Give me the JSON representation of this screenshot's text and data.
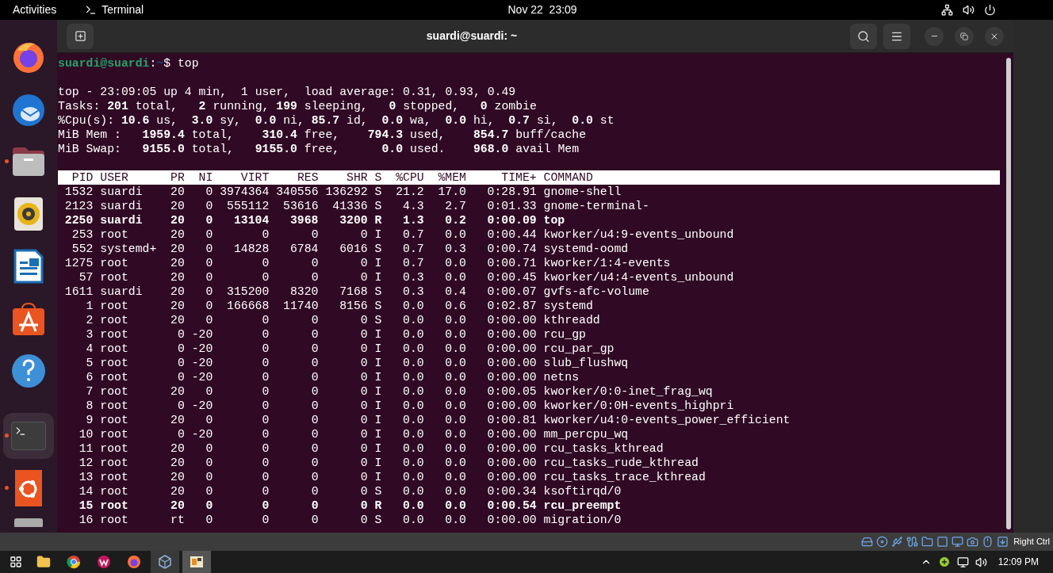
{
  "top_bar": {
    "activities": "Activities",
    "app_name": "Terminal",
    "clock": "Nov 22  23:09"
  },
  "dock": [
    {
      "kind": "firefox",
      "running": false,
      "active": false
    },
    {
      "kind": "thunderbird",
      "running": false,
      "active": false
    },
    {
      "kind": "files",
      "running": true,
      "active": false
    },
    {
      "kind": "rhythmbox",
      "running": false,
      "active": false
    },
    {
      "kind": "writer",
      "running": false,
      "active": false
    },
    {
      "kind": "software",
      "running": false,
      "active": false
    },
    {
      "kind": "help",
      "running": false,
      "active": false
    },
    {
      "kind": "separator"
    },
    {
      "kind": "terminal",
      "running": true,
      "active": true
    },
    {
      "kind": "ubuntu",
      "running": true,
      "active": false
    },
    {
      "kind": "drive"
    }
  ],
  "window": {
    "title": "suardi@suardi: ~"
  },
  "terminal": {
    "prompt": {
      "user_host": "suardi@suardi",
      "separator": ":",
      "path": "~",
      "symbol": "$ ",
      "command": "top"
    },
    "summary": [
      "top - 23:09:05 up 4 min,  1 user,  load average: 0.31, 0.93, 0.49",
      "Tasks: **201** total,   **2** running, **199** sleeping,   **0** stopped,   **0** zombie",
      "%Cpu(s): **10.6** us,  **3.0** sy,  **0.0** ni, **85.7** id,  **0.0** wa,  **0.0** hi,  **0.7** si,  **0.0** st",
      "MiB Mem :   **1959.4** total,    **310.4** free,    **794.3** used,    **854.7** buff/cache",
      "MiB Swap:   **9155.0** total,   **9155.0** free,      **0.0** used.    **968.0** avail Mem"
    ],
    "columns": [
      "PID",
      "USER",
      "PR",
      "NI",
      "VIRT",
      "RES",
      "SHR",
      "S",
      "%CPU",
      "%MEM",
      "TIME+",
      "COMMAND"
    ],
    "rows": [
      {
        "bold": false,
        "cells": [
          "1532",
          "suardi",
          "20",
          "0",
          "3974364",
          "340556",
          "136292",
          "S",
          "21.2",
          "17.0",
          "0:28.91",
          "gnome-shell"
        ]
      },
      {
        "bold": false,
        "cells": [
          "2123",
          "suardi",
          "20",
          "0",
          "555112",
          "53616",
          "41336",
          "S",
          "4.3",
          "2.7",
          "0:01.33",
          "gnome-terminal-"
        ]
      },
      {
        "bold": true,
        "cells": [
          "2250",
          "suardi",
          "20",
          "0",
          "13104",
          "3968",
          "3200",
          "R",
          "1.3",
          "0.2",
          "0:00.09",
          "top"
        ]
      },
      {
        "bold": false,
        "cells": [
          "253",
          "root",
          "20",
          "0",
          "0",
          "0",
          "0",
          "I",
          "0.7",
          "0.0",
          "0:00.44",
          "kworker/u4:9-events_unbound"
        ]
      },
      {
        "bold": false,
        "cells": [
          "552",
          "systemd+",
          "20",
          "0",
          "14828",
          "6784",
          "6016",
          "S",
          "0.7",
          "0.3",
          "0:00.74",
          "systemd-oomd"
        ]
      },
      {
        "bold": false,
        "cells": [
          "1275",
          "root",
          "20",
          "0",
          "0",
          "0",
          "0",
          "I",
          "0.7",
          "0.0",
          "0:00.71",
          "kworker/1:4-events"
        ]
      },
      {
        "bold": false,
        "cells": [
          "57",
          "root",
          "20",
          "0",
          "0",
          "0",
          "0",
          "I",
          "0.3",
          "0.0",
          "0:00.45",
          "kworker/u4:4-events_unbound"
        ]
      },
      {
        "bold": false,
        "cells": [
          "1611",
          "suardi",
          "20",
          "0",
          "315200",
          "8320",
          "7168",
          "S",
          "0.3",
          "0.4",
          "0:00.07",
          "gvfs-afc-volume"
        ]
      },
      {
        "bold": false,
        "cells": [
          "1",
          "root",
          "20",
          "0",
          "166668",
          "11740",
          "8156",
          "S",
          "0.0",
          "0.6",
          "0:02.87",
          "systemd"
        ]
      },
      {
        "bold": false,
        "cells": [
          "2",
          "root",
          "20",
          "0",
          "0",
          "0",
          "0",
          "S",
          "0.0",
          "0.0",
          "0:00.00",
          "kthreadd"
        ]
      },
      {
        "bold": false,
        "cells": [
          "3",
          "root",
          "0",
          "-20",
          "0",
          "0",
          "0",
          "I",
          "0.0",
          "0.0",
          "0:00.00",
          "rcu_gp"
        ]
      },
      {
        "bold": false,
        "cells": [
          "4",
          "root",
          "0",
          "-20",
          "0",
          "0",
          "0",
          "I",
          "0.0",
          "0.0",
          "0:00.00",
          "rcu_par_gp"
        ]
      },
      {
        "bold": false,
        "cells": [
          "5",
          "root",
          "0",
          "-20",
          "0",
          "0",
          "0",
          "I",
          "0.0",
          "0.0",
          "0:00.00",
          "slub_flushwq"
        ]
      },
      {
        "bold": false,
        "cells": [
          "6",
          "root",
          "0",
          "-20",
          "0",
          "0",
          "0",
          "I",
          "0.0",
          "0.0",
          "0:00.00",
          "netns"
        ]
      },
      {
        "bold": false,
        "cells": [
          "7",
          "root",
          "20",
          "0",
          "0",
          "0",
          "0",
          "I",
          "0.0",
          "0.0",
          "0:00.05",
          "kworker/0:0-inet_frag_wq"
        ]
      },
      {
        "bold": false,
        "cells": [
          "8",
          "root",
          "0",
          "-20",
          "0",
          "0",
          "0",
          "I",
          "0.0",
          "0.0",
          "0:00.00",
          "kworker/0:0H-events_highpri"
        ]
      },
      {
        "bold": false,
        "cells": [
          "9",
          "root",
          "20",
          "0",
          "0",
          "0",
          "0",
          "I",
          "0.0",
          "0.0",
          "0:00.81",
          "kworker/u4:0-events_power_efficient"
        ]
      },
      {
        "bold": false,
        "cells": [
          "10",
          "root",
          "0",
          "-20",
          "0",
          "0",
          "0",
          "I",
          "0.0",
          "0.0",
          "0:00.00",
          "mm_percpu_wq"
        ]
      },
      {
        "bold": false,
        "cells": [
          "11",
          "root",
          "20",
          "0",
          "0",
          "0",
          "0",
          "I",
          "0.0",
          "0.0",
          "0:00.00",
          "rcu_tasks_kthread"
        ]
      },
      {
        "bold": false,
        "cells": [
          "12",
          "root",
          "20",
          "0",
          "0",
          "0",
          "0",
          "I",
          "0.0",
          "0.0",
          "0:00.00",
          "rcu_tasks_rude_kthread"
        ]
      },
      {
        "bold": false,
        "cells": [
          "13",
          "root",
          "20",
          "0",
          "0",
          "0",
          "0",
          "I",
          "0.0",
          "0.0",
          "0:00.00",
          "rcu_tasks_trace_kthread"
        ]
      },
      {
        "bold": false,
        "cells": [
          "14",
          "root",
          "20",
          "0",
          "0",
          "0",
          "0",
          "S",
          "0.0",
          "0.0",
          "0:00.34",
          "ksoftirqd/0"
        ]
      },
      {
        "bold": true,
        "cells": [
          "15",
          "root",
          "20",
          "0",
          "0",
          "0",
          "0",
          "R",
          "0.0",
          "0.0",
          "0:00.54",
          "rcu_preempt"
        ]
      },
      {
        "bold": false,
        "cells": [
          "16",
          "root",
          "rt",
          "0",
          "0",
          "0",
          "0",
          "S",
          "0.0",
          "0.0",
          "0:00.00",
          "migration/0"
        ]
      }
    ]
  },
  "vm_status": {
    "host_key": "Right Ctrl"
  },
  "taskbar": {
    "clock": "12:09 PM"
  }
}
